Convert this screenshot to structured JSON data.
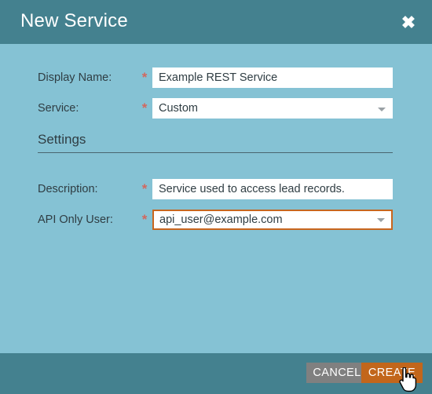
{
  "dialog": {
    "title": "New Service",
    "close_icon": "close-icon"
  },
  "form": {
    "fields": [
      {
        "label": "Display Name:",
        "required_marker": "*",
        "type": "text",
        "value": "Example REST Service",
        "placeholder": "",
        "focused": false
      },
      {
        "label": "Service:",
        "required_marker": "*",
        "type": "select",
        "value": "Custom",
        "placeholder": "",
        "focused": false
      },
      {
        "label": "Description:",
        "required_marker": "*",
        "type": "text",
        "value": "Service used to access lead  records.",
        "placeholder": "",
        "focused": false
      },
      {
        "label": "API Only User:",
        "required_marker": "*",
        "type": "select",
        "value": "api_user@example.com",
        "placeholder": "",
        "focused": true
      }
    ]
  },
  "settings_section": {
    "heading": "Settings"
  },
  "footer": {
    "cancel_label": "CANCEL",
    "create_label": "CREATE"
  },
  "colors": {
    "header_teal": "#44818f",
    "body_blue": "#85c2d4",
    "footer_teal": "#44818f",
    "accent_orange": "#c2661b",
    "focus_orange": "#c8661e",
    "required_red": "#d2685f",
    "cancel_gray": "#808080",
    "label_text": "#2f3d43"
  }
}
